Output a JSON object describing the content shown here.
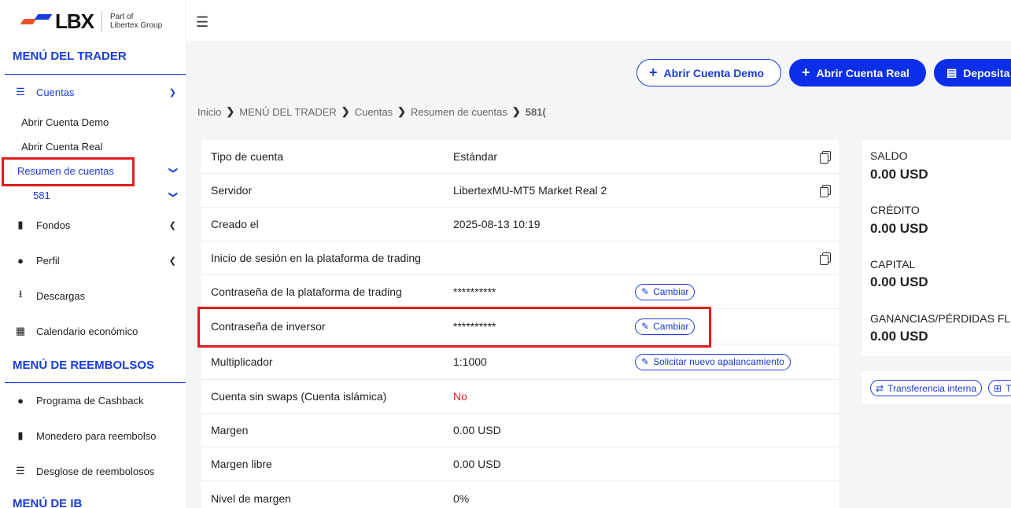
{
  "header": {
    "logo_text": "LBX",
    "logo_sub_line1": "Part of",
    "logo_sub_line2": "Libertex Group",
    "menu_icon": "hamburger-icon"
  },
  "sidebar": {
    "section1_title": "MENÚ DEL TRADER",
    "cuentas": "Cuentas",
    "abrir_demo": "Abrir Cuenta Demo",
    "abrir_real": "Abrir Cuenta Real",
    "resumen": "Resumen de cuentas",
    "account_number": "581",
    "fondos": "Fondos",
    "perfil": "Perfil",
    "descargas": "Descargas",
    "calendario": "Calendario económico",
    "section2_title": "MENÚ DE REEMBOLSOS",
    "cashback": "Programa de Cashback",
    "monedero": "Monedero para reembolso",
    "desglose": "Desglose de reembolosos",
    "section3_title": "MENÚ DE IB"
  },
  "actions": {
    "demo_label": "Abrir Cuenta Demo",
    "real_label": "Abrir Cuenta Real",
    "deposit_label": "Deposita"
  },
  "breadcrumb": [
    "Inicio",
    "MENÚ DEL TRADER",
    "Cuentas",
    "Resumen de cuentas",
    "581("
  ],
  "account_details": [
    {
      "label": "Tipo de cuenta",
      "value": "Estándar"
    },
    {
      "label": "Servidor",
      "value": "LibertexMU-MT5 Market Real 2"
    },
    {
      "label": "Creado el",
      "value": "2025-08-13 10:19"
    },
    {
      "label": "Inicio de sesión en la plataforma de trading",
      "value": ""
    },
    {
      "label": "Contraseña de la plataforma de trading",
      "value": "**********",
      "action": "Cambiar"
    },
    {
      "label": "Contraseña de inversor",
      "value": "**********",
      "action": "Cambiar"
    },
    {
      "label": "Multiplicador",
      "value": "1:1000",
      "action": "Solicitar nuevo apalancamiento"
    },
    {
      "label": "Cuenta sin swaps (Cuenta islámica)",
      "value": "No"
    },
    {
      "label": "Margen",
      "value": "0.00 USD"
    },
    {
      "label": "Margen libre",
      "value": "0.00 USD"
    },
    {
      "label": "Nivel de margen",
      "value": "0%"
    }
  ],
  "summary": {
    "saldo_label": "SALDO",
    "saldo": "0.00 USD",
    "credito_label": "CRÉDITO",
    "credito": "0.00 USD",
    "capital_label": "CAPITAL",
    "capital": "0.00 USD",
    "ganancias_label": "GANANCIAS/PÉRDIDAS FLU",
    "ganancias": "0.00 USD"
  },
  "bottom_actions": {
    "transfer": "Transferencia interna",
    "extra": "T"
  },
  "colors": {
    "accent": "#1a3cd8",
    "highlight": "#e11d1d",
    "brand_orange": "#e8542a"
  }
}
